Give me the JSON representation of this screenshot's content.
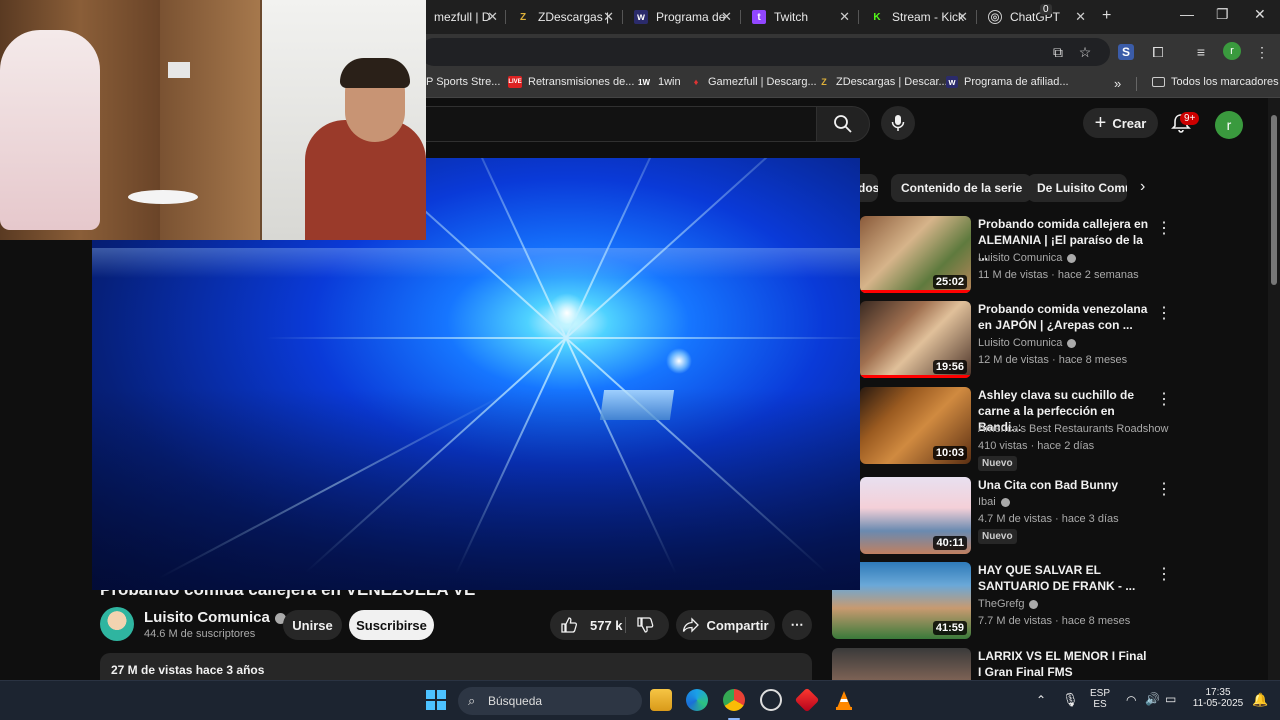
{
  "browser": {
    "tabs": [
      {
        "label": "mezfull | D",
        "icon": "gamezfull-icon"
      },
      {
        "label": "ZDescargas |",
        "icon": "zdescargas-icon"
      },
      {
        "label": "Programa de",
        "icon": "program-icon"
      },
      {
        "label": "Twitch",
        "icon": "twitch-icon"
      },
      {
        "label": "Stream - Kick",
        "icon": "kick-icon"
      },
      {
        "label": "ChatGPT",
        "icon": "chatgpt-icon"
      }
    ],
    "tab_badge": "0",
    "profile_letter": "r",
    "bookmarks": [
      {
        "label": "P Sports Stre..."
      },
      {
        "label": "Retransmisiones de...",
        "icon_text": "LIVE"
      },
      {
        "label": "1win",
        "icon_text": "1W"
      },
      {
        "label": "Gamezfull | Descarg..."
      },
      {
        "label": "ZDescargas | Descar...",
        "icon_text": "Z"
      },
      {
        "label": "Programa de afiliad..."
      }
    ],
    "bookmarks_more": "»",
    "all_bookmarks": "Todos los marcadores"
  },
  "youtube": {
    "create_label": "Crear",
    "notif_badge": "9+",
    "avatar_letter": "r",
    "chips": [
      "dos",
      "Contenido de la serie",
      "De Luisito Comu"
    ],
    "video_title": "Probando comida callejera en VENEZUELA VE",
    "channel": {
      "name": "Luisito Comunica",
      "subs": "44.6 M de suscriptores",
      "join": "Unirse",
      "subscribe": "Suscribirse"
    },
    "likes": "577 k",
    "share": "Compartir",
    "views_meta": "27 M de vistas  hace 3 años",
    "suggestions": [
      {
        "title": "Probando comida callejera en ALEMANIA | ¡El paraíso de la ...",
        "channel": "Luisito Comunica",
        "meta": "11 M de vistas · hace 2 semanas",
        "duration": "25:02",
        "badge": "",
        "watched": 1.0
      },
      {
        "title": "Probando comida venezolana en JAPÓN | ¿Arepas con ...",
        "channel": "Luisito Comunica",
        "meta": "12 M de vistas · hace 8 meses",
        "duration": "19:56",
        "badge": "",
        "watched": 1.0
      },
      {
        "title": "Ashley clava su cuchillo de carne a la perfección en Bandi...",
        "channel": "America's Best Restaurants Roadshow",
        "meta": "410 vistas · hace 2 días",
        "duration": "10:03",
        "badge": "Nuevo",
        "watched": 0
      },
      {
        "title": "Una Cita con Bad Bunny",
        "channel": "Ibai",
        "meta": "4.7 M de vistas · hace 3 días",
        "duration": "40:11",
        "badge": "Nuevo",
        "watched": 0
      },
      {
        "title": "HAY QUE SALVAR EL SANTUARIO DE FRANK - ...",
        "channel": "TheGrefg",
        "meta": "7.7 M de vistas · hace 8 meses",
        "duration": "41:59",
        "badge": "",
        "watched": 0
      },
      {
        "title": "LARRIX VS EL MENOR I Final I Gran Final FMS Internacional ...",
        "channel": "",
        "meta": "",
        "duration": "",
        "badge": "",
        "watched": 0
      }
    ]
  },
  "taskbar": {
    "search_placeholder": "Búsqueda",
    "lang": "ESP",
    "region": "ES",
    "time": "17:35",
    "date": "11-05-2025"
  },
  "colors": {
    "accent_red": "#ff0000",
    "bg": "#0f0f0f"
  }
}
